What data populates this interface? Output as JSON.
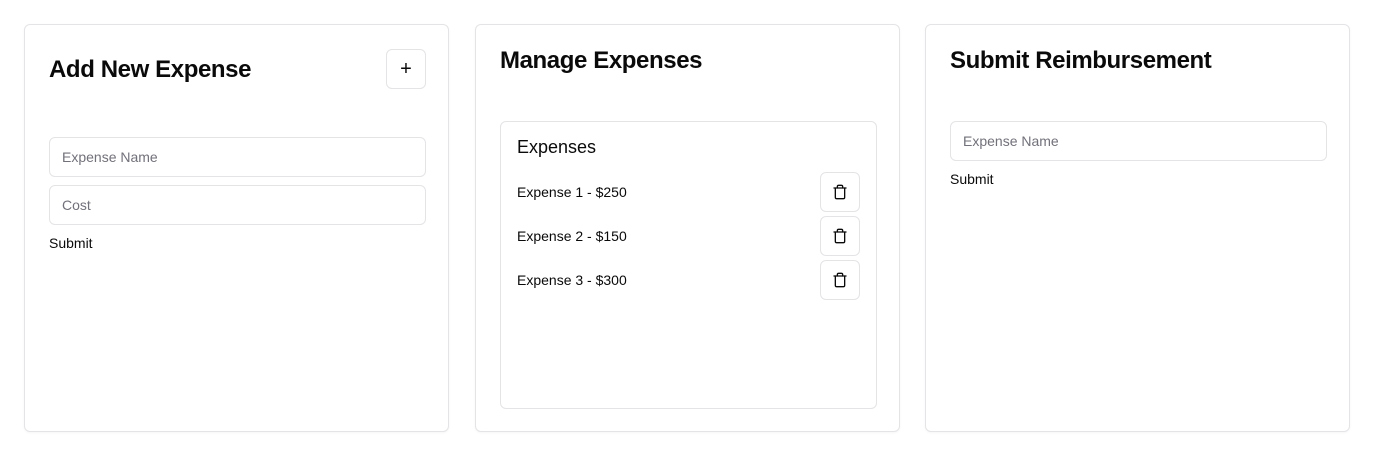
{
  "add_expense": {
    "title": "Add New Expense",
    "add_button_label": "+",
    "name_placeholder": "Expense Name",
    "cost_placeholder": "Cost",
    "submit_label": "Submit"
  },
  "manage_expenses": {
    "title": "Manage Expenses",
    "list_title": "Expenses",
    "items": [
      {
        "label": "Expense 1 - $250"
      },
      {
        "label": "Expense 2 - $150"
      },
      {
        "label": "Expense 3 - $300"
      }
    ],
    "delete_icon": "trash-icon"
  },
  "submit_reimbursement": {
    "title": "Submit Reimbursement",
    "name_placeholder": "Expense Name",
    "submit_label": "Submit"
  },
  "colors": {
    "border": "#e4e4e7",
    "text": "#0a0a0a",
    "placeholder": "#71717a"
  }
}
